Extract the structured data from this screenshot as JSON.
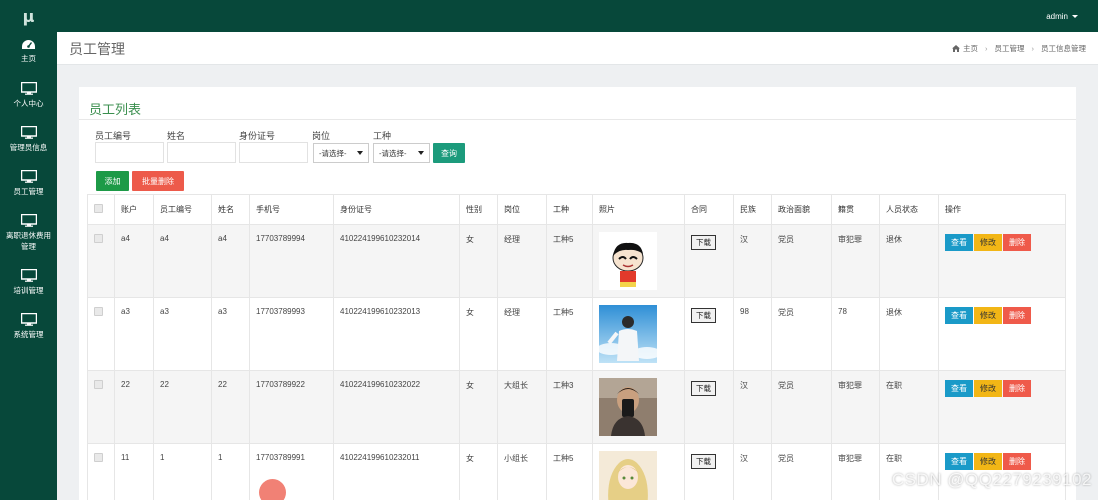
{
  "app": {
    "logo": "μ",
    "user": "admin"
  },
  "sidebar": {
    "items": [
      {
        "label": "主页",
        "icon": "dashboard-icon"
      },
      {
        "label": "个人中心",
        "icon": "monitor-icon"
      },
      {
        "label": "管理员信息",
        "icon": "monitor-icon"
      },
      {
        "label": "员工管理",
        "icon": "monitor-icon"
      },
      {
        "label": "离职退休费用管理",
        "icon": "monitor-icon"
      },
      {
        "label": "培训管理",
        "icon": "monitor-icon"
      },
      {
        "label": "系统管理",
        "icon": "monitor-icon"
      }
    ]
  },
  "header": {
    "title": "员工管理",
    "breadcrumb": [
      "主页",
      "员工管理",
      "员工信息管理"
    ]
  },
  "panel": {
    "title": "员工列表"
  },
  "filters": {
    "labels": [
      "员工编号",
      "姓名",
      "身份证号",
      "岗位",
      "工种"
    ],
    "post_select": "-请选择-",
    "type_select": "-请选择-",
    "query_label": "查询"
  },
  "buttons": {
    "add": "添加",
    "batch_delete": "批量删除"
  },
  "table": {
    "headers": [
      "账户",
      "员工编号",
      "姓名",
      "手机号",
      "身份证号",
      "性别",
      "岗位",
      "工种",
      "照片",
      "合同",
      "民族",
      "政治面貌",
      "籍贯",
      "人员状态",
      "操作"
    ],
    "download_label": "下载",
    "actions": {
      "view": "查看",
      "edit": "修改",
      "delete": "删除"
    },
    "rows": [
      {
        "account": "a4",
        "emp_no": "a4",
        "name": "a4",
        "phone": "17703789994",
        "id_no": "410224199610232014",
        "gender": "女",
        "post": "经理",
        "type": "工种5",
        "photo": "cartoon-boy-avatar",
        "ethnicity": "汉",
        "political": "党员",
        "hometown": "审犯罪",
        "status": "退休"
      },
      {
        "account": "a3",
        "emp_no": "a3",
        "name": "a3",
        "phone": "17703789993",
        "id_no": "410224199610232013",
        "gender": "女",
        "post": "经理",
        "type": "工种5",
        "photo": "boy-sky-photo",
        "ethnicity": "98",
        "political": "党员",
        "hometown": "78",
        "status": "退休"
      },
      {
        "account": "22",
        "emp_no": "22",
        "name": "22",
        "phone": "17703789922",
        "id_no": "410224199610232022",
        "gender": "女",
        "post": "大组长",
        "type": "工种3",
        "photo": "man-selfie-photo",
        "ethnicity": "汉",
        "political": "党员",
        "hometown": "审犯罪",
        "status": "在职"
      },
      {
        "account": "11",
        "emp_no": "1",
        "name": "1",
        "phone": "17703789991",
        "id_no": "410224199610232011",
        "gender": "女",
        "post": "小组长",
        "type": "工种5",
        "photo": "anime-girl-photo",
        "ethnicity": "汉",
        "political": "党员",
        "hometown": "审犯罪",
        "status": "在职"
      }
    ]
  },
  "watermark": "CSDN @QQ2279239102"
}
